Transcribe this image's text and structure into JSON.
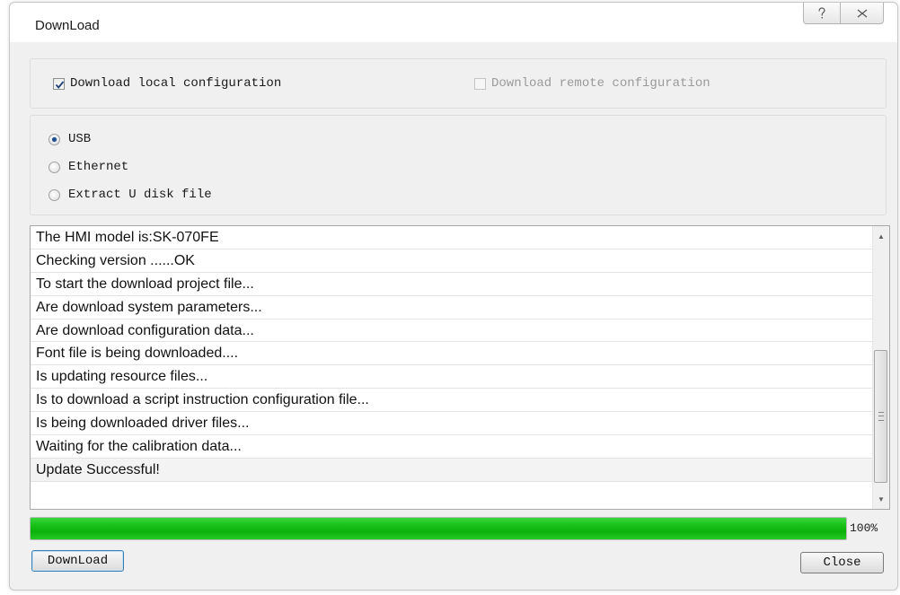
{
  "window": {
    "title": "DownLoad",
    "help_icon": "question-mark-icon",
    "close_icon": "close-x-icon"
  },
  "config": {
    "local_label": "Download local configuration",
    "local_checked": true,
    "remote_label": "Download remote configuration",
    "remote_checked": false,
    "remote_enabled": false
  },
  "connection": {
    "selected": "USB",
    "options": [
      "USB",
      "Ethernet",
      "Extract U disk file"
    ]
  },
  "log": {
    "lines": [
      "The HMI model is:SK-070FE",
      "Checking version ......OK",
      "To start the download project file...",
      "Are download system parameters...",
      "Are download configuration data...",
      "Font file is being downloaded....",
      "Is updating resource files...",
      "Is to download a script instruction configuration file...",
      "Is being downloaded driver files...",
      "Waiting for the calibration data...",
      "Update Successful!"
    ]
  },
  "progress": {
    "value": 1.0,
    "label": "100%",
    "color": "#17c117"
  },
  "buttons": {
    "download_label": "DownLoad",
    "close_label": "Close"
  }
}
